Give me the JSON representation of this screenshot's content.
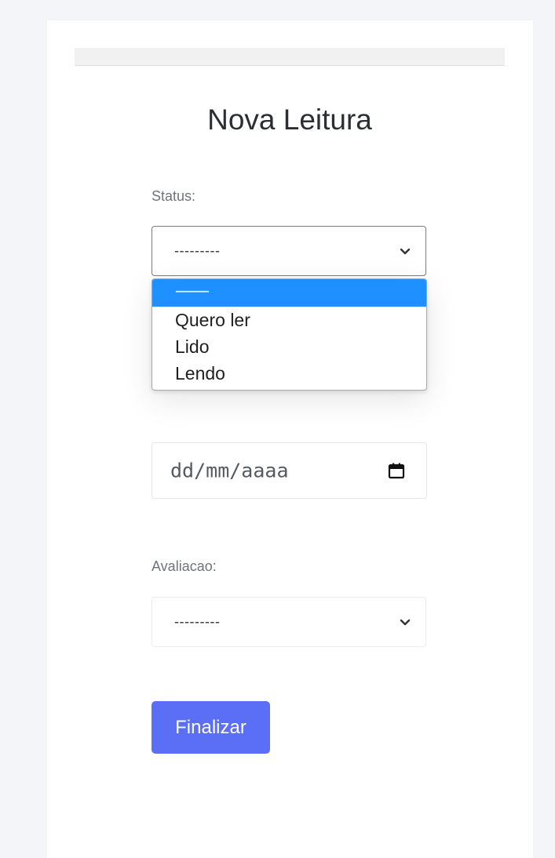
{
  "form": {
    "title": "Nova Leitura",
    "status": {
      "label": "Status:",
      "selected": "---------",
      "options": [
        "---------",
        "Quero ler",
        "Lido",
        "Lendo"
      ]
    },
    "date": {
      "placeholder": "dd/mm/aaaa"
    },
    "rating": {
      "label": "Avaliacao:",
      "selected": "---------"
    },
    "submit_label": "Finalizar"
  },
  "colors": {
    "accent": "#5b6ff6",
    "option_highlight": "#1e90ff",
    "page_background": "#f4f5f9"
  }
}
